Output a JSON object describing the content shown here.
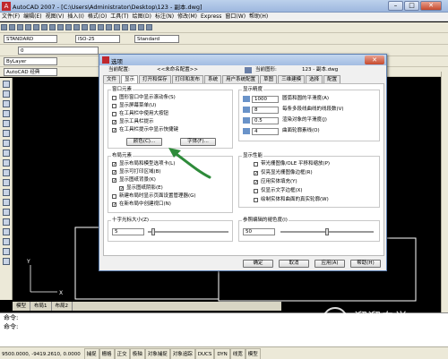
{
  "window": {
    "title": "AutoCAD 2007 - [C:\\Users\\Administrator\\Desktop\\123 - 副本.dwg]",
    "logo": "A"
  },
  "menu": [
    "文件(F)",
    "编辑(E)",
    "视图(V)",
    "插入(I)",
    "格式(O)",
    "工具(T)",
    "绘图(D)",
    "标注(N)",
    "修改(M)",
    "Express",
    "窗口(W)",
    "帮助(H)"
  ],
  "toolbar": {
    "textstyle": "STANDARD",
    "dimstyle": "ISO-25",
    "tablestyle": "Standard",
    "layer": "0",
    "linetype": "ByLayer",
    "workspace": "AutoCAD 经典"
  },
  "model_tabs": [
    "模型",
    "布局1",
    "布局2"
  ],
  "command": {
    "line1": "命令:",
    "line2": "命令:"
  },
  "status": {
    "coords": "9500.0000, -9419.2610, 0.0000",
    "toggles": [
      "捕捉",
      "栅格",
      "正交",
      "极轴",
      "对象捕捉",
      "对象追踪",
      "DUCS",
      "DYN",
      "线宽",
      "模型"
    ]
  },
  "dialog": {
    "title": "选项",
    "current_profile_label": "当前配置:",
    "current_profile": "<<未命名配置>>",
    "current_drawing_label": "当前图形:",
    "current_drawing": "123 - 副本.dwg",
    "tabs": [
      "文件",
      "显示",
      "打开和保存",
      "打印和发布",
      "系统",
      "用户系统配置",
      "草图",
      "三维建模",
      "选择",
      "配置"
    ],
    "active_tab": "显示",
    "window_elements": {
      "title": "窗口元素",
      "options": [
        {
          "label": "图形窗口中显示滚动条(S)",
          "checked": false
        },
        {
          "label": "显示屏幕菜单(U)",
          "checked": false
        },
        {
          "label": "在工具栏中使用大按钮",
          "checked": false
        },
        {
          "label": "显示工具栏提示",
          "checked": true
        },
        {
          "label": "在工具栏提示中显示快捷键",
          "checked": true
        }
      ],
      "colors_button": "颜色(C)...",
      "fonts_button": "字体(F)..."
    },
    "layout_elements": {
      "title": "布局元素",
      "options": [
        {
          "label": "显示布局和模型选项卡(L)",
          "checked": true
        },
        {
          "label": "显示可打印区域(B)",
          "checked": true
        },
        {
          "label": "显示图纸背景(K)",
          "checked": true
        },
        {
          "label": "显示图纸阴影(E)",
          "checked": true
        },
        {
          "label": "新建布局时显示页面设置管理器(G)",
          "checked": false
        },
        {
          "label": "在新布局中创建视口(N)",
          "checked": true
        }
      ]
    },
    "crosshair": {
      "title": "十字光标大小(Z)",
      "value": "5",
      "level": 0.05
    },
    "display_resolution": {
      "title": "显示精度",
      "rows": [
        {
          "value": "1000",
          "label": "圆弧和圆的平滑度(A)"
        },
        {
          "value": "8",
          "label": "每条多段线曲线的线段数(V)"
        },
        {
          "value": "0.5",
          "label": "渲染对象的平滑度(J)"
        },
        {
          "value": "4",
          "label": "曲面轮廓素线(O)"
        }
      ]
    },
    "display_performance": {
      "title": "显示性能",
      "options": [
        {
          "label": "带光栅图像/OLE 平移和缩放(P)",
          "checked": false
        },
        {
          "label": "仅亮显光栅图像边框(R)",
          "checked": true
        },
        {
          "label": "应用实体填充(Y)",
          "checked": true
        },
        {
          "label": "仅显示文字边框(X)",
          "checked": false
        },
        {
          "label": "绘制实体和曲面的真实轮廓(W)",
          "checked": false
        }
      ]
    },
    "fade": {
      "title": "参照编辑的褪色度(I)",
      "value": "50",
      "level": 0.5
    },
    "buttons": {
      "ok": "确定",
      "cancel": "取消",
      "apply": "应用(A)",
      "help": "帮助(H)"
    }
  },
  "watermark": {
    "name": "溜溜自学",
    "url": "ZIXUE.3D66.COM"
  },
  "colors": {
    "title_bar": "#a3bde2",
    "canvas": "#000000",
    "arrow": "#2e8b3a"
  }
}
